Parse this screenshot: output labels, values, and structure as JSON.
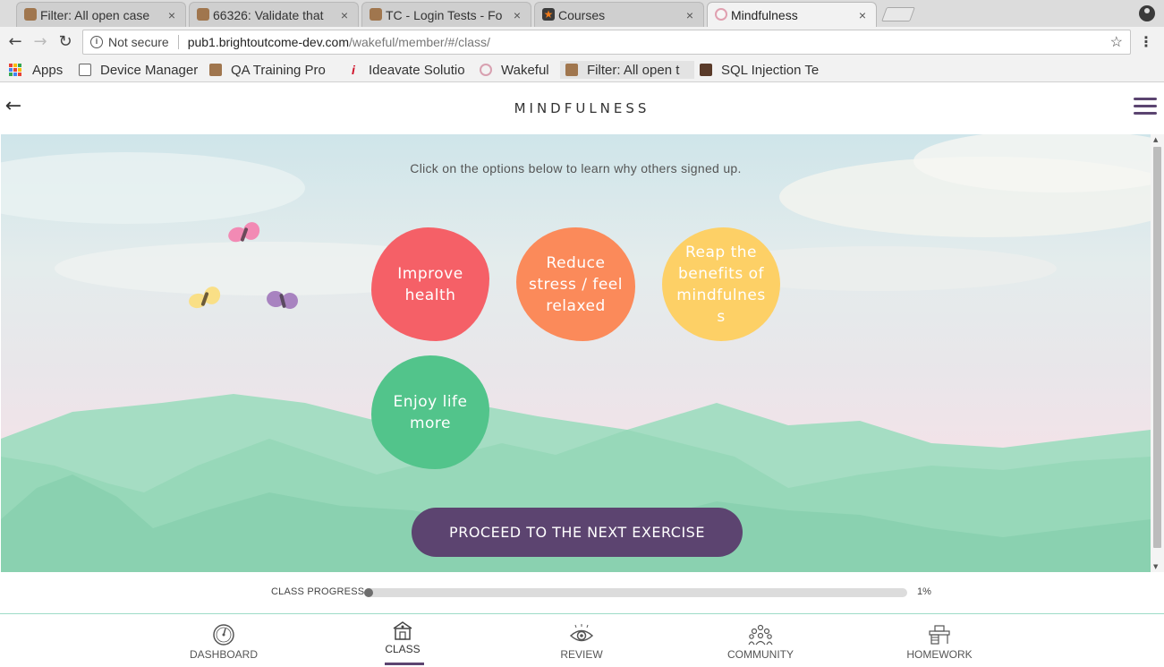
{
  "browser": {
    "tabs": [
      {
        "title": "Filter: All open case",
        "favicon": "bug-icon",
        "active": false
      },
      {
        "title": "66326: Validate that",
        "favicon": "bug-icon",
        "active": false
      },
      {
        "title": "TC - Login Tests - Fo",
        "favicon": "bug-icon",
        "active": false
      },
      {
        "title": "Courses",
        "favicon": "star-icon",
        "active": false
      },
      {
        "title": "Mindfulness",
        "favicon": "wakeful-icon",
        "active": true
      }
    ],
    "close_glyph": "×",
    "address": {
      "security_label": "Not secure",
      "host": "pub1.brightoutcome-dev.com",
      "path": "/wakeful/member/#/class/"
    },
    "bookmarks": [
      {
        "label": "Apps"
      },
      {
        "label": "Device Manager"
      },
      {
        "label": "QA Training Pro"
      },
      {
        "label": "Ideavate Solutio"
      },
      {
        "label": "Wakeful"
      },
      {
        "label": "Filter: All open t"
      },
      {
        "label": "SQL Injection Te"
      }
    ]
  },
  "header": {
    "title": "MINDFULNESS"
  },
  "scene": {
    "instruction": "Click on the options below to learn why others signed up.",
    "options": [
      {
        "label": "Improve health",
        "color": "#f56067"
      },
      {
        "label": "Reduce stress / feel relaxed",
        "color": "#fb8a5a"
      },
      {
        "label": "Reap the benefits of mindfulnes s",
        "color": "#fdd066"
      },
      {
        "label": "Enjoy life more",
        "color": "#52c48b"
      }
    ],
    "proceed_label": "PROCEED TO THE NEXT EXERCISE"
  },
  "progress": {
    "label": "CLASS PROGRESS",
    "percent_text": "1%",
    "value": 0.01
  },
  "bottom_nav": {
    "items": [
      {
        "label": "DASHBOARD",
        "icon": "gauge-icon"
      },
      {
        "label": "CLASS",
        "icon": "school-icon"
      },
      {
        "label": "REVIEW",
        "icon": "eye-icon"
      },
      {
        "label": "COMMUNITY",
        "icon": "people-icon"
      },
      {
        "label": "HOMEWORK",
        "icon": "desk-icon"
      }
    ],
    "active": "CLASS"
  },
  "colors": {
    "accent": "#5c4470",
    "nav_border": "#9edcc8"
  }
}
